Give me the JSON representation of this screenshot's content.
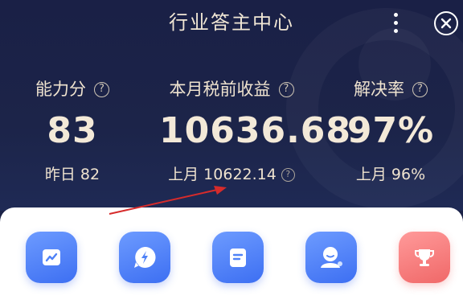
{
  "header": {
    "title": "行业答主中心"
  },
  "stats": [
    {
      "label": "能力分",
      "value": "83",
      "sub": "昨日 82"
    },
    {
      "label": "本月税前收益",
      "value": "10636.68",
      "sub": "上月 10622.14"
    },
    {
      "label": "解决率",
      "value": "97%",
      "sub": "上月 96%"
    }
  ],
  "help_glyph": "?",
  "icons": [
    "trend-icon",
    "lightning-icon",
    "document-icon",
    "user-support-icon",
    "trophy-icon"
  ],
  "colors": {
    "background": "#1b2247",
    "gold_text": "#efe3cf",
    "tile_blue": "#4f82f7",
    "tile_red": "#f07575",
    "arrow_red": "#d62b2b"
  }
}
